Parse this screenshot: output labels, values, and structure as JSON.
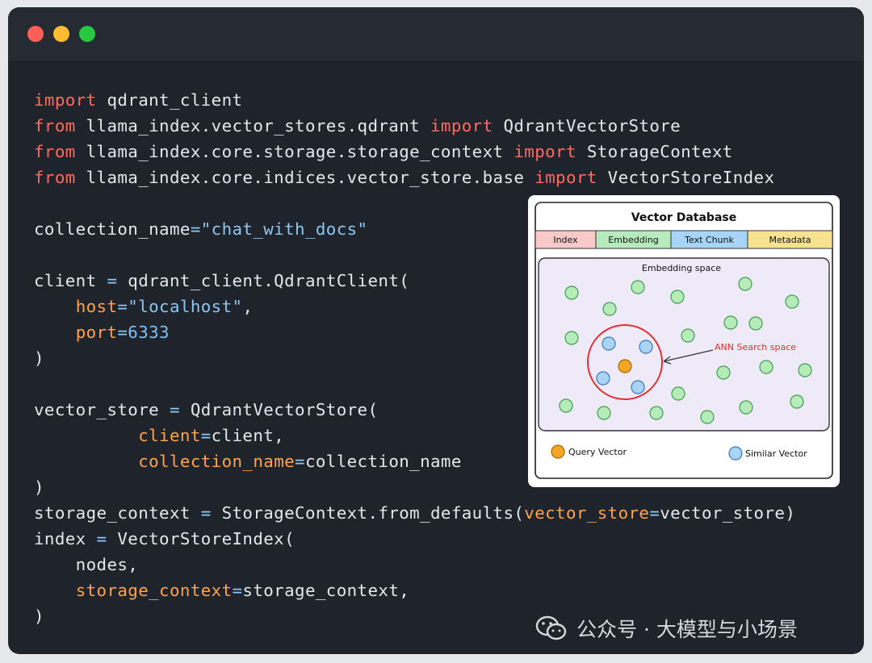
{
  "window": {
    "traffic_lights": [
      {
        "name": "close",
        "color": "#ff5f57"
      },
      {
        "name": "minimize",
        "color": "#febc2e"
      },
      {
        "name": "maximize",
        "color": "#28c840"
      }
    ]
  },
  "code": {
    "lines": [
      {
        "tokens": [
          {
            "t": "import",
            "c": "kw"
          },
          {
            "t": " qdrant_client",
            "c": ""
          }
        ]
      },
      {
        "tokens": [
          {
            "t": "from",
            "c": "kw"
          },
          {
            "t": " llama_index.vector_stores.qdrant ",
            "c": ""
          },
          {
            "t": "import",
            "c": "kw"
          },
          {
            "t": " QdrantVectorStore",
            "c": ""
          }
        ]
      },
      {
        "tokens": [
          {
            "t": "from",
            "c": "kw"
          },
          {
            "t": " llama_index.core.storage.storage_context ",
            "c": ""
          },
          {
            "t": "import",
            "c": "kw"
          },
          {
            "t": " StorageContext",
            "c": ""
          }
        ]
      },
      {
        "tokens": [
          {
            "t": "from",
            "c": "kw"
          },
          {
            "t": " llama_index.core.indices.vector_store.base ",
            "c": ""
          },
          {
            "t": "import",
            "c": "kw"
          },
          {
            "t": " VectorStoreIndex",
            "c": ""
          }
        ]
      },
      {
        "tokens": []
      },
      {
        "tokens": [
          {
            "t": "collection_name",
            "c": ""
          },
          {
            "t": "=",
            "c": "op"
          },
          {
            "t": "\"chat_with_docs\"",
            "c": "str"
          }
        ]
      },
      {
        "tokens": []
      },
      {
        "tokens": [
          {
            "t": "client ",
            "c": ""
          },
          {
            "t": "=",
            "c": "op"
          },
          {
            "t": " qdrant_client.QdrantClient(",
            "c": ""
          }
        ]
      },
      {
        "tokens": [
          {
            "t": "    ",
            "c": ""
          },
          {
            "t": "host",
            "c": "param"
          },
          {
            "t": "=",
            "c": "op"
          },
          {
            "t": "\"localhost\"",
            "c": "str"
          },
          {
            "t": ",",
            "c": ""
          }
        ]
      },
      {
        "tokens": [
          {
            "t": "    ",
            "c": ""
          },
          {
            "t": "port",
            "c": "param"
          },
          {
            "t": "=",
            "c": "op"
          },
          {
            "t": "6333",
            "c": "num"
          }
        ]
      },
      {
        "tokens": [
          {
            "t": ")",
            "c": ""
          }
        ]
      },
      {
        "tokens": []
      },
      {
        "tokens": [
          {
            "t": "vector_store ",
            "c": ""
          },
          {
            "t": "=",
            "c": "op"
          },
          {
            "t": " QdrantVectorStore(",
            "c": ""
          }
        ]
      },
      {
        "tokens": [
          {
            "t": "          ",
            "c": ""
          },
          {
            "t": "client",
            "c": "param"
          },
          {
            "t": "=",
            "c": "op"
          },
          {
            "t": "client,",
            "c": ""
          }
        ]
      },
      {
        "tokens": [
          {
            "t": "          ",
            "c": ""
          },
          {
            "t": "collection_name",
            "c": "param"
          },
          {
            "t": "=",
            "c": "op"
          },
          {
            "t": "collection_name",
            "c": ""
          }
        ]
      },
      {
        "tokens": [
          {
            "t": ")",
            "c": ""
          }
        ]
      },
      {
        "tokens": [
          {
            "t": "storage_context ",
            "c": ""
          },
          {
            "t": "=",
            "c": "op"
          },
          {
            "t": " StorageContext.from_defaults(",
            "c": ""
          },
          {
            "t": "vector_store",
            "c": "param"
          },
          {
            "t": "=",
            "c": "op"
          },
          {
            "t": "vector_store)",
            "c": ""
          }
        ]
      },
      {
        "tokens": [
          {
            "t": "index ",
            "c": ""
          },
          {
            "t": "=",
            "c": "op"
          },
          {
            "t": " VectorStoreIndex(",
            "c": ""
          }
        ]
      },
      {
        "tokens": [
          {
            "t": "    nodes,",
            "c": ""
          }
        ]
      },
      {
        "tokens": [
          {
            "t": "    ",
            "c": ""
          },
          {
            "t": "storage_context",
            "c": "param"
          },
          {
            "t": "=",
            "c": "op"
          },
          {
            "t": "storage_context,",
            "c": ""
          }
        ]
      },
      {
        "tokens": [
          {
            "t": ")",
            "c": ""
          }
        ]
      }
    ]
  },
  "diagram": {
    "title": "Vector Database",
    "columns": [
      {
        "label": "Index",
        "color": "#f9c9c9"
      },
      {
        "label": "Embedding",
        "color": "#b7ebbd"
      },
      {
        "label": "Text Chunk",
        "color": "#a8d5f7"
      },
      {
        "label": "Metadata",
        "color": "#f7e38f"
      }
    ],
    "space_label": "Embedding space",
    "annotation": "ANN Search space",
    "legend": {
      "query": "Query Vector",
      "similar": "Similar Vector"
    },
    "colors": {
      "point": "#b6ecb8",
      "point_stroke": "#3f9b55",
      "similar": "#a9d4f5",
      "similar_stroke": "#3b78b8",
      "query": "#f6a623",
      "query_stroke": "#a4670e",
      "circle": "#e03131"
    }
  },
  "watermark": {
    "text": "公众号 · 大模型与小场景",
    "icon": "wechat-icon"
  }
}
